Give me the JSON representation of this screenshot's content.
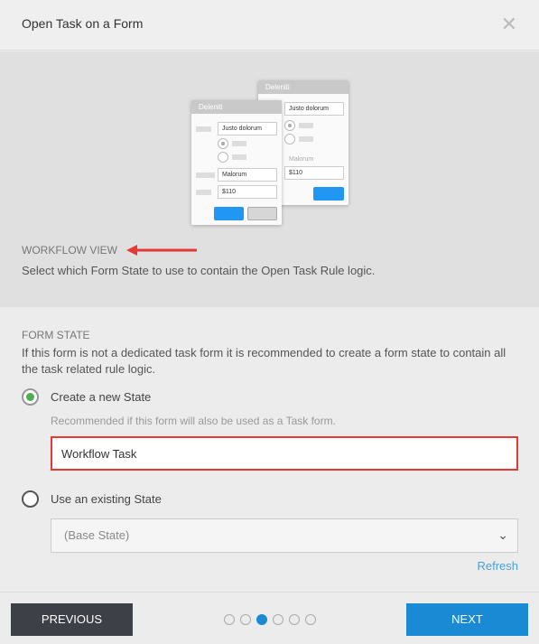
{
  "dialog": {
    "title": "Open Task on a Form",
    "close_icon": "close-icon"
  },
  "illustration": {
    "back_card": {
      "header": "Deleniti",
      "field1": "Justo dolorum",
      "label": "Malorum",
      "field2": "$110"
    },
    "front_card": {
      "header": "Deleniti",
      "field1": "Justo dolorum",
      "field2": "Malorum",
      "field3": "$110"
    }
  },
  "workflow_view": {
    "label": "WORKFLOW VIEW",
    "description": "Select which Form State to use to contain the Open Task Rule logic.",
    "arrow_color": "#e53935"
  },
  "form_state": {
    "label": "FORM STATE",
    "description": "If this form is not a dedicated task form it is recommended to create a form state to contain all the task related rule logic.",
    "option_new": {
      "label": "Create a new State",
      "selected": true,
      "hint": "Recommended if this form will also be used as a Task form.",
      "value": "Workflow Task"
    },
    "option_existing": {
      "label": "Use an existing State",
      "selected": false,
      "select_value": "(Base State)",
      "refresh_label": "Refresh"
    }
  },
  "footer": {
    "previous_label": "PREVIOUS",
    "next_label": "NEXT",
    "steps_total": 6,
    "current_step": 3
  }
}
